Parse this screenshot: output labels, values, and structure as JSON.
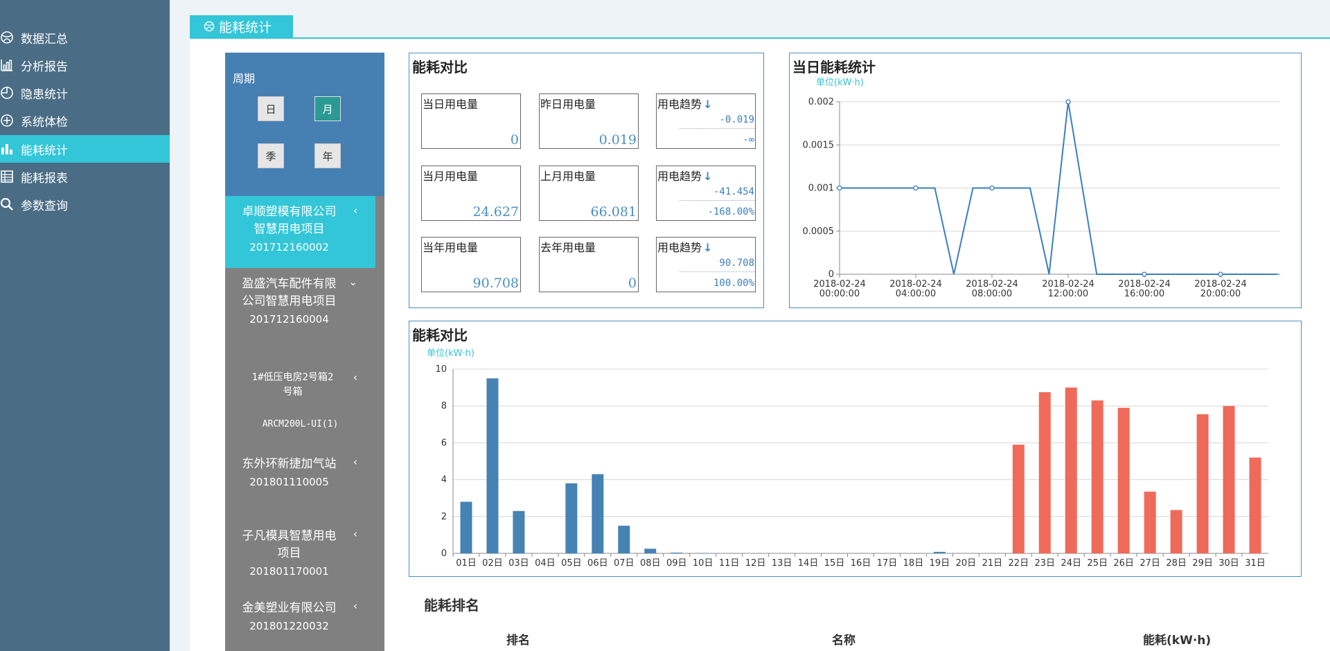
{
  "nav": {
    "items": [
      {
        "label": "数据汇总",
        "icon": "dashboard-icon",
        "active": false
      },
      {
        "label": "分析报告",
        "icon": "bar-chart-icon",
        "active": false
      },
      {
        "label": "隐患统计",
        "icon": "pie-chart-icon",
        "active": false
      },
      {
        "label": "系统体检",
        "icon": "plus-circle-icon",
        "active": false
      },
      {
        "label": "能耗统计",
        "icon": "column-chart-icon",
        "active": true
      },
      {
        "label": "能耗报表",
        "icon": "table-icon",
        "active": false
      },
      {
        "label": "参数查询",
        "icon": "search-icon",
        "active": false
      }
    ]
  },
  "page": {
    "title": "能耗统计"
  },
  "period": {
    "label": "周期",
    "buttons": [
      {
        "label": "日",
        "active": false
      },
      {
        "label": "月",
        "active": true
      },
      {
        "label": "季",
        "active": false
      },
      {
        "label": "年",
        "active": false
      }
    ]
  },
  "projects": [
    {
      "name": "卓顺塑模有限公司智慧用电项目",
      "code": "201712160002",
      "chevron": "‹",
      "active": true
    },
    {
      "name": "盈盛汽车配件有限公司智慧用电项目",
      "code": "201712160004",
      "chevron": "⌄",
      "active": false
    },
    {
      "name": "东外环新捷加气站",
      "code": "201801110005",
      "chevron": "‹",
      "active": false
    },
    {
      "name": "子凡模具智慧用电项目",
      "code": "201801170001",
      "chevron": "‹",
      "active": false
    },
    {
      "name": "金美塑业有限公司",
      "code": "201801220032",
      "chevron": "‹",
      "active": false
    }
  ],
  "subitems": [
    {
      "label": "1#低压电房2号箱2号箱",
      "chevron": "‹"
    },
    {
      "label": "ARCM200L-UI(1)"
    }
  ],
  "comparison": {
    "title": "能耗对比",
    "cards": [
      {
        "label": "当日用电量",
        "value": "0"
      },
      {
        "label": "昨日用电量",
        "value": "0.019"
      },
      {
        "label": "用电趋势",
        "arrow": "↓",
        "value1": "-0.019",
        "value2": "-∞"
      },
      {
        "label": "当月用电量",
        "value": "24.627"
      },
      {
        "label": "上月用电量",
        "value": "66.081"
      },
      {
        "label": "用电趋势",
        "arrow": "↓",
        "value1": "-41.454",
        "value2": "-168.00%"
      },
      {
        "label": "当年用电量",
        "value": "90.708"
      },
      {
        "label": "去年用电量",
        "value": "0"
      },
      {
        "label": "用电趋势",
        "arrow": "↓",
        "value1": "90.708",
        "value2": "100.00%"
      }
    ]
  },
  "daily": {
    "title": "当日能耗统计",
    "unit": "单位(kW·h)"
  },
  "monthly": {
    "title": "能耗对比",
    "unit": "单位(kW·h)"
  },
  "chart_data": [
    {
      "type": "line",
      "title": "当日能耗统计",
      "ylabel": "单位(kW·h)",
      "x": [
        "2018-02-24 00:00:00",
        "2018-02-24 02:00:00",
        "2018-02-24 04:00:00",
        "2018-02-24 05:00:00",
        "2018-02-24 06:00:00",
        "2018-02-24 07:00:00",
        "2018-02-24 08:00:00",
        "2018-02-24 10:00:00",
        "2018-02-24 11:00:00",
        "2018-02-24 12:00:00",
        "2018-02-24 13:30:00",
        "2018-02-24 16:00:00",
        "2018-02-24 20:00:00",
        "2018-02-24 23:00:00"
      ],
      "values": [
        0.001,
        0.001,
        0.001,
        0.001,
        0,
        0.001,
        0.001,
        0.001,
        0,
        0.002,
        0,
        0,
        0,
        0
      ],
      "xticks": [
        {
          "date": "2018-02-24",
          "time": "00:00:00"
        },
        {
          "date": "2018-02-24",
          "time": "04:00:00"
        },
        {
          "date": "2018-02-24",
          "time": "08:00:00"
        },
        {
          "date": "2018-02-24",
          "time": "12:00:00"
        },
        {
          "date": "2018-02-24",
          "time": "16:00:00"
        },
        {
          "date": "2018-02-24",
          "time": "20:00:00"
        }
      ],
      "yticks": [
        "0",
        "0.0005",
        "0.001",
        "0.0015",
        "0.002"
      ],
      "ylim": [
        0,
        0.002
      ],
      "grid": true,
      "color": "#3a7ebf"
    },
    {
      "type": "bar",
      "title": "能耗对比",
      "ylabel": "单位(kW·h)",
      "categories": [
        "01日",
        "02日",
        "03日",
        "04日",
        "05日",
        "06日",
        "07日",
        "08日",
        "09日",
        "10日",
        "11日",
        "12日",
        "13日",
        "14日",
        "15日",
        "16日",
        "17日",
        "18日",
        "19日",
        "20日",
        "21日",
        "22日",
        "23日",
        "24日",
        "25日",
        "26日",
        "27日",
        "28日",
        "29日",
        "30日",
        "31日"
      ],
      "series": [
        {
          "values": [
            2.8,
            9.5,
            2.3,
            0,
            3.8,
            4.3,
            1.5,
            0.25,
            0.04,
            0.02,
            0.01,
            0,
            0,
            0,
            0,
            0.01,
            0,
            0,
            0.08,
            0,
            0,
            null,
            null,
            null,
            null,
            null,
            null,
            null,
            null,
            null,
            null
          ],
          "color": "#4682b4"
        },
        {
          "values": [
            null,
            null,
            null,
            null,
            null,
            null,
            null,
            null,
            null,
            null,
            null,
            null,
            null,
            null,
            null,
            null,
            null,
            null,
            null,
            null,
            null,
            5.9,
            8.75,
            9.0,
            8.3,
            7.9,
            3.35,
            2.35,
            7.55,
            8.0,
            5.2
          ],
          "color": "#f06a5a"
        }
      ],
      "yticks": [
        "0",
        "2",
        "4",
        "6",
        "8",
        "10"
      ],
      "ylim": [
        0,
        10
      ],
      "grid": true
    }
  ],
  "ranking": {
    "title": "能耗排名",
    "columns": [
      "排名",
      "名称",
      "能耗(kW·h)"
    ]
  }
}
